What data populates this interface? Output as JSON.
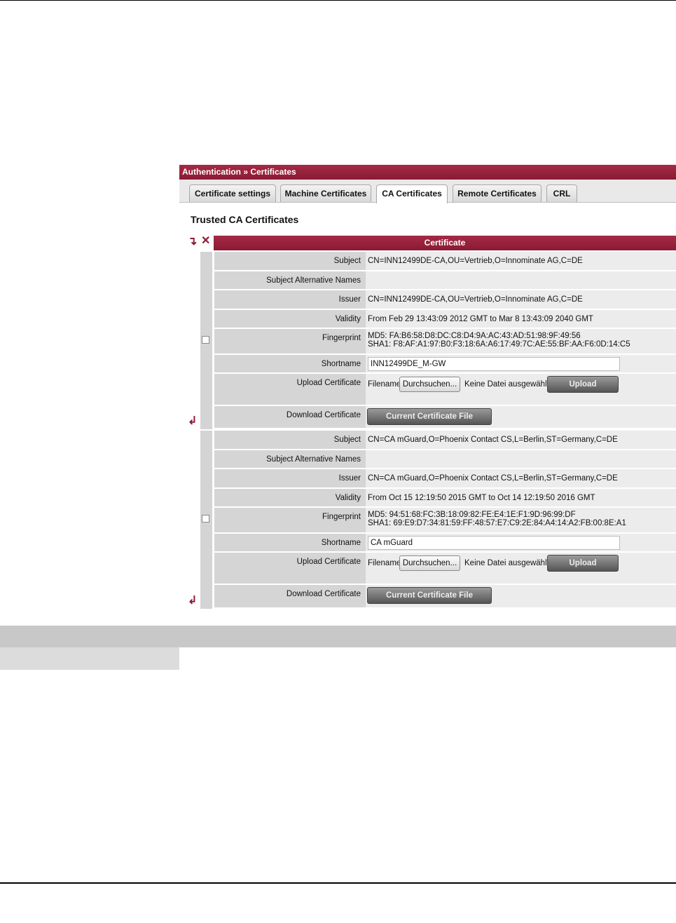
{
  "breadcrumb": "Authentication » Certificates",
  "tabs": [
    {
      "label": "Certificate settings"
    },
    {
      "label": "Machine Certificates"
    },
    {
      "label": "CA Certificates"
    },
    {
      "label": "Remote Certificates"
    },
    {
      "label": "CRL"
    }
  ],
  "active_tab": "CA Certificates",
  "section_title": "Trusted CA Certificates",
  "table_header": "Certificate",
  "labels": {
    "subject": "Subject",
    "san": "Subject Alternative Names",
    "issuer": "Issuer",
    "validity": "Validity",
    "fingerprint": "Fingerprint",
    "shortname": "Shortname",
    "upload": "Upload Certificate",
    "download": "Download Certificate",
    "filename": "Filename:",
    "browse": "Durchsuchen...",
    "no_file": "Keine Datei ausgewählt.",
    "upload_btn": "Upload",
    "download_btn": "Current Certificate File"
  },
  "certs": [
    {
      "subject": "CN=INN12499DE-CA,OU=Vertrieb,O=Innominate AG,C=DE",
      "san": "",
      "issuer": "CN=INN12499DE-CA,OU=Vertrieb,O=Innominate AG,C=DE",
      "validity": "From Feb 29 13:43:09 2012 GMT to Mar 8 13:43:09 2040 GMT",
      "md5": "MD5: FA:B6:58:D8:DC:C8:D4:9A:AC:43:AD:51:98:9F:49:56",
      "sha1": "SHA1: F8:AF:A1:97:B0:F3:18:6A:A6:17:49:7C:AE:55:BF:AA:F6:0D:14:C5",
      "shortname": "INN12499DE_M-GW",
      "selected": false
    },
    {
      "subject": "CN=CA mGuard,O=Phoenix Contact CS,L=Berlin,ST=Germany,C=DE",
      "san": "",
      "issuer": "CN=CA mGuard,O=Phoenix Contact CS,L=Berlin,ST=Germany,C=DE",
      "validity": "From Oct 15 12:19:50 2015 GMT to Oct 14 12:19:50 2016 GMT",
      "md5": "MD5: 94:51:68:FC:3B:18:09:82:FE:E4:1E:F1:9D:96:99:DF",
      "sha1": "SHA1: 69:E9:D7:34:81:59:FF:48:57:E7:C9:2E:84:A4:14:A2:FB:00:8E:A1",
      "shortname": "CA mGuard",
      "selected": false
    }
  ],
  "icons": {
    "insert": "insert-row-icon",
    "delete": "delete-row-icon",
    "insert_after": "insert-after-icon"
  }
}
